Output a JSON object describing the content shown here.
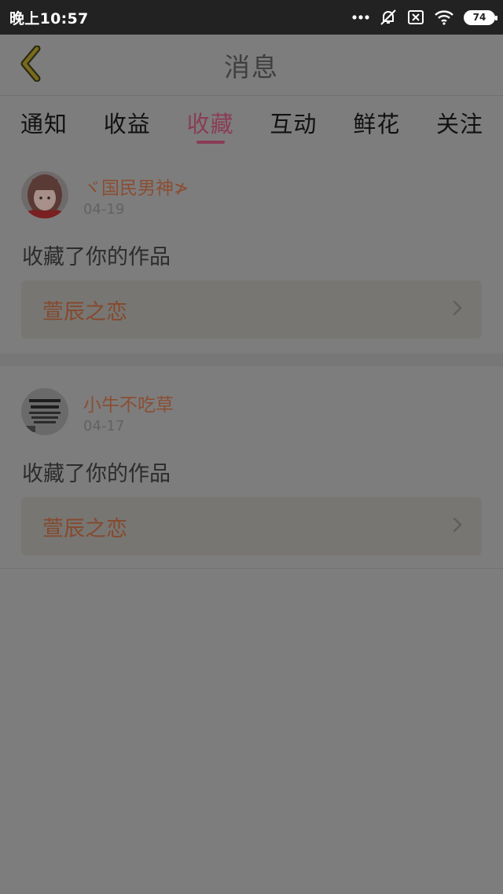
{
  "status_bar": {
    "time": "晚上10:57",
    "battery": "74",
    "icons": [
      "more-dots-icon",
      "notification-off-icon",
      "sim-x-icon",
      "wifi-icon",
      "battery-icon"
    ]
  },
  "header": {
    "title": "消息",
    "back_icon": "chevron-left-icon"
  },
  "tabs": [
    {
      "label": "通知"
    },
    {
      "label": "收益"
    },
    {
      "label": "收藏",
      "active": true
    },
    {
      "label": "互动"
    },
    {
      "label": "鲜花"
    },
    {
      "label": "关注"
    }
  ],
  "messages": [
    {
      "user": "ヾ国民男神≯",
      "date": "04-19",
      "action": "收藏了你的作品",
      "work": "萱辰之恋"
    },
    {
      "user": "小牛不吃草",
      "date": "04-17",
      "action": "收藏了你的作品",
      "work": "萱辰之恋"
    }
  ],
  "colors": {
    "accent": "#8a3d55",
    "username": "#8b4e33",
    "overlay_bg": "#7d7d7d"
  }
}
